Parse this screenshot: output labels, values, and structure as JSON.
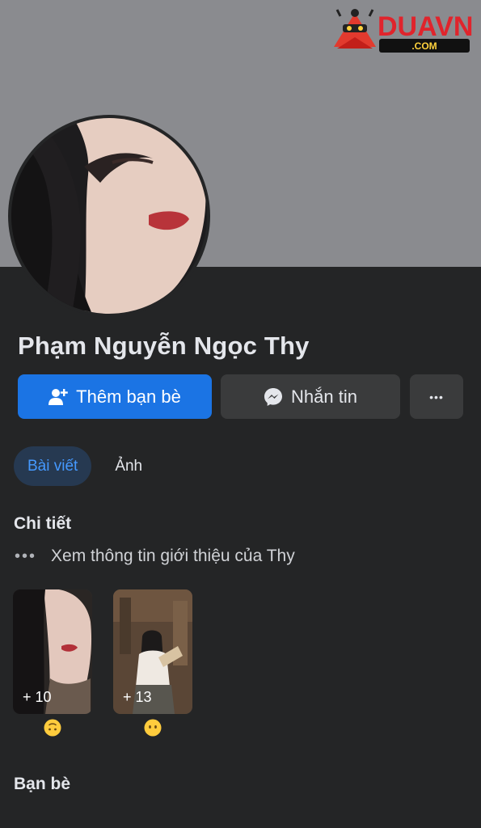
{
  "watermark": {
    "brand": "DUAVN",
    "domain": ".COM"
  },
  "profile": {
    "name": "Phạm Nguyễn Ngọc Thy"
  },
  "actions": {
    "add_friend_label": "Thêm bạn bè",
    "message_label": "Nhắn tin",
    "more_label": "•••"
  },
  "tabs": [
    {
      "label": "Bài viết",
      "active": true
    },
    {
      "label": "Ảnh",
      "active": false
    }
  ],
  "details": {
    "title": "Chi tiết",
    "about_text": "Xem thông tin giới thiệu của Thy",
    "about_icon": "•••"
  },
  "featured": [
    {
      "count_label": "+ 10",
      "emoji": "upside-down-face"
    },
    {
      "count_label": "+ 13",
      "emoji": "no-mouth-face"
    }
  ],
  "friends": {
    "title": "Bạn bè"
  },
  "colors": {
    "cover": "#8a8b8f",
    "background": "#242526",
    "primary": "#1b74e4",
    "secondary_button": "#3a3b3c",
    "tab_active_bg": "#263951",
    "tab_active_text": "#4599ff"
  }
}
